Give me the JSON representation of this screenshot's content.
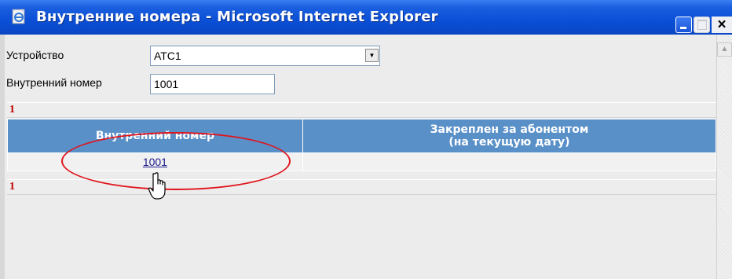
{
  "window": {
    "title": "Внутренние номера - Microsoft Internet Explorer",
    "icon": "ie-page-icon",
    "close_glyph": "×"
  },
  "form": {
    "device_label": "Устройство",
    "device_value": "АТС1",
    "ext_label": "Внутренний номер",
    "ext_value": "1001"
  },
  "results": {
    "count_top": "1",
    "count_bottom": "1"
  },
  "table": {
    "columns": [
      "Внутренний номер",
      "Закреплен за абонентом\n(на текущую дату)"
    ],
    "rows": [
      {
        "extension": "1001",
        "subscriber": ""
      }
    ]
  },
  "colors": {
    "title_bar": "#0a4fd6",
    "header": "#5a90c8",
    "highlight": "#e0141c",
    "count": "#c00000"
  }
}
